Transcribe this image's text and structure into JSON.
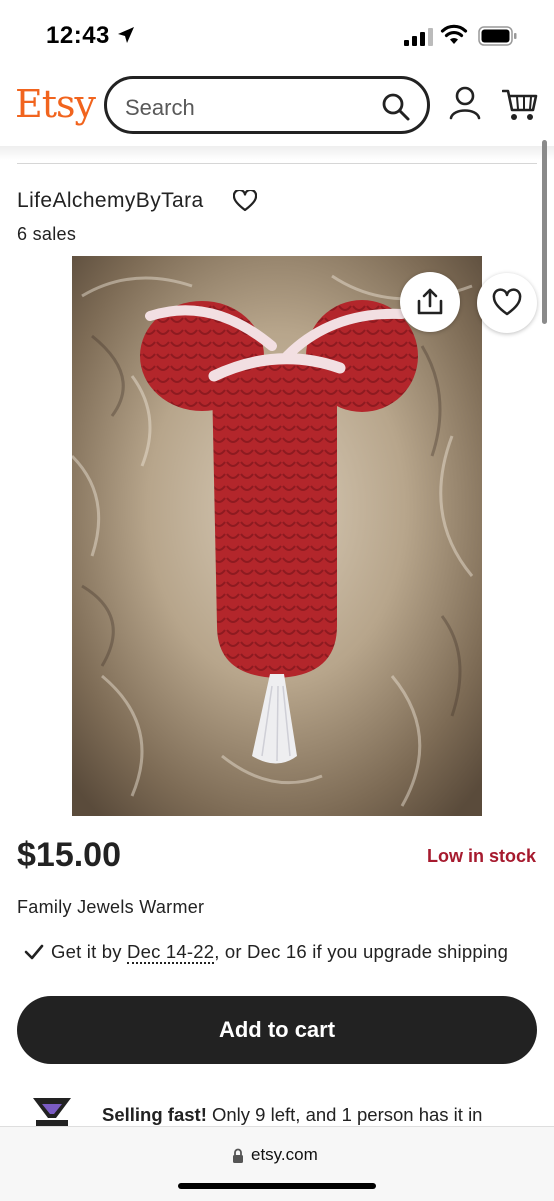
{
  "status_bar": {
    "time": "12:43"
  },
  "header": {
    "logo": "Etsy",
    "search_placeholder": "Search"
  },
  "shop": {
    "name": "LifeAlchemyByTara",
    "sales": "6 sales"
  },
  "listing": {
    "price": "$15.00",
    "stock": "Low in stock",
    "title": "Family Jewels Warmer",
    "delivery_prefix": "Get it by ",
    "delivery_dates": "Dec 14-22",
    "delivery_suffix": ", or Dec 16 if you upgrade shipping",
    "add_to_cart": "Add to cart",
    "selling_fast_bold": "Selling fast!",
    "selling_fast_text": " Only 9 left, and 1 person has it in"
  },
  "browser": {
    "url": "etsy.com"
  },
  "colors": {
    "brand_orange": "#f1641e",
    "stock_red": "#a61a2e",
    "button_dark": "#222222",
    "crochet_red": "#b3262b"
  },
  "icons": [
    "location-arrow-icon",
    "signal-icon",
    "wifi-icon",
    "battery-icon",
    "search-icon",
    "account-icon",
    "cart-icon",
    "heart-icon",
    "share-icon",
    "checkmark-icon",
    "hourglass-icon",
    "lock-icon"
  ]
}
